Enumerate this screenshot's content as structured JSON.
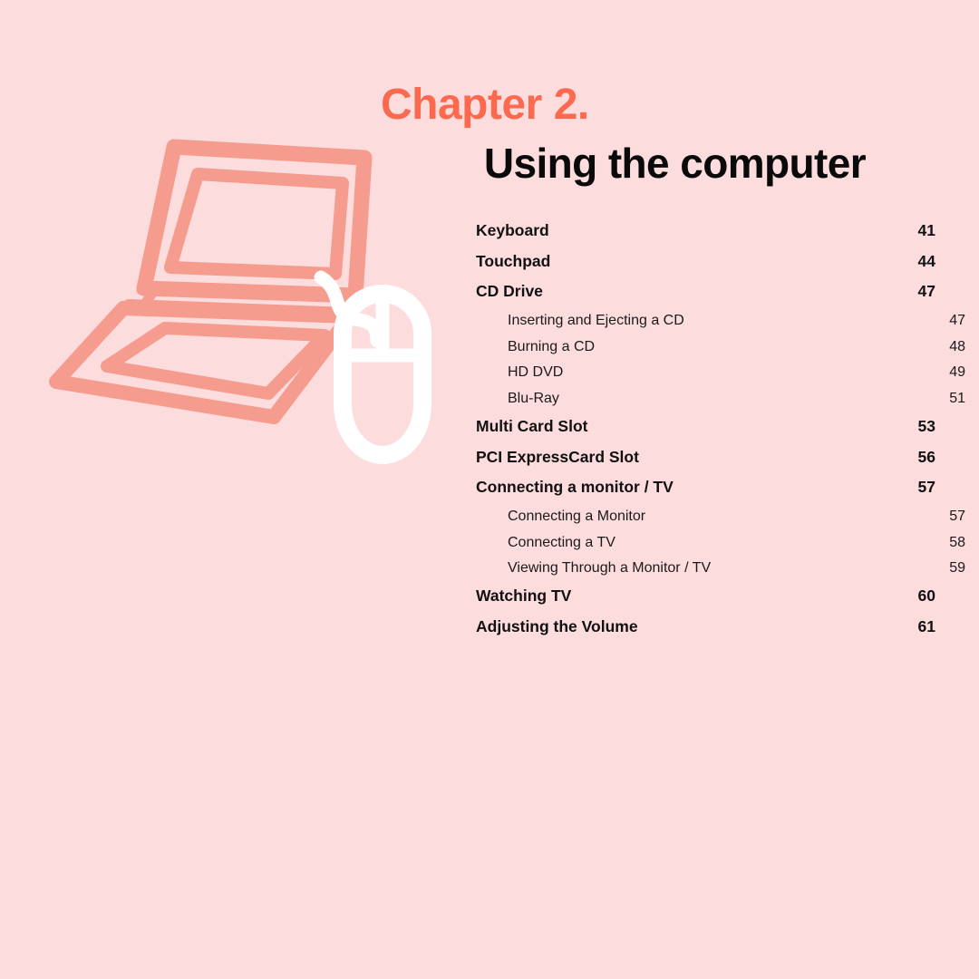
{
  "page": {
    "background_color": "#fddcdd",
    "accent_color": "#fb6a4f",
    "illustration_color": "#f59c8e",
    "mouse_color": "#ffffff",
    "text_color": "#111111"
  },
  "heading": {
    "chapter_label": "Chapter 2.",
    "chapter_title": "Using the computer"
  },
  "illustration": {
    "laptop_icon_name": "laptop-illustration",
    "mouse_icon_name": "computer-mouse-illustration"
  },
  "toc": {
    "entries": [
      {
        "label": "Keyboard",
        "page": "41",
        "level": 1
      },
      {
        "label": "Touchpad",
        "page": "44",
        "level": 1
      },
      {
        "label": "CD Drive",
        "page": "47",
        "level": 1
      },
      {
        "label": "Inserting and Ejecting a CD",
        "page": "47",
        "level": 2
      },
      {
        "label": "Burning a CD",
        "page": "48",
        "level": 2
      },
      {
        "label": "HD DVD",
        "page": "49",
        "level": 2
      },
      {
        "label": "Blu-Ray",
        "page": "51",
        "level": 2
      },
      {
        "label": "Multi Card Slot",
        "page": "53",
        "level": 1
      },
      {
        "label": "PCI ExpressCard Slot",
        "page": "56",
        "level": 1
      },
      {
        "label": "Connecting a monitor / TV",
        "page": "57",
        "level": 1
      },
      {
        "label": "Connecting a Monitor",
        "page": "57",
        "level": 2
      },
      {
        "label": "Connecting a TV",
        "page": "58",
        "level": 2
      },
      {
        "label": "Viewing Through a Monitor / TV",
        "page": "59",
        "level": 2
      },
      {
        "label": "Watching TV",
        "page": "60",
        "level": 1
      },
      {
        "label": "Adjusting the Volume",
        "page": "61",
        "level": 1
      }
    ]
  }
}
